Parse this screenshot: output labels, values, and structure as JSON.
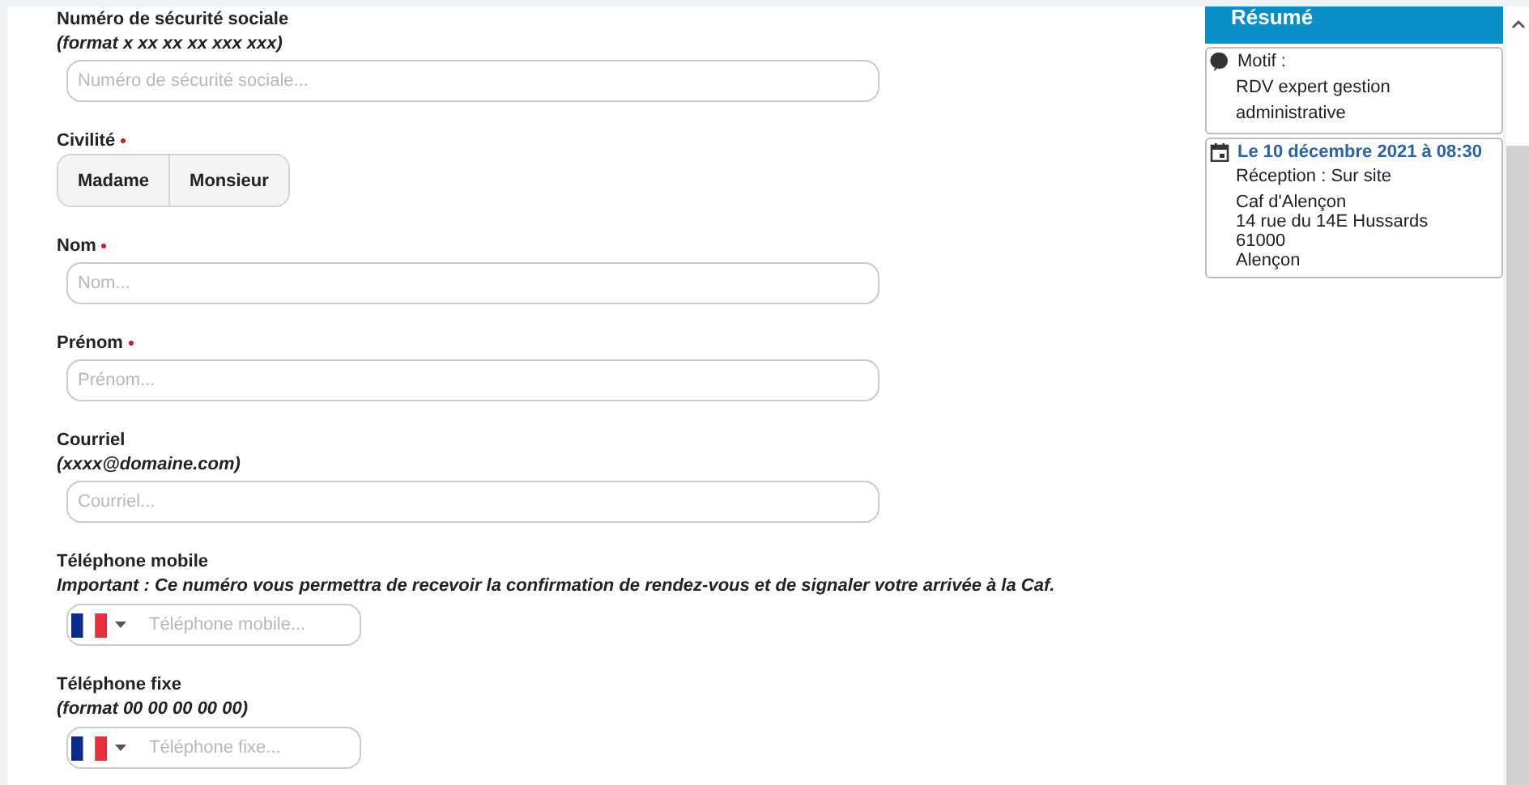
{
  "form": {
    "fields": [
      {
        "kind": "text",
        "label": "Numéro de sécurité sociale",
        "required": false,
        "hint": "(format x xx xx xx xxx xxx)",
        "placeholder": "Numéro de sécurité sociale..."
      },
      {
        "kind": "segmented",
        "label": "Civilité",
        "required": true,
        "options": [
          {
            "label": "Madame",
            "selected": false
          },
          {
            "label": "Monsieur",
            "selected": false
          }
        ]
      },
      {
        "kind": "text",
        "label": "Nom",
        "required": true,
        "placeholder": "Nom..."
      },
      {
        "kind": "text",
        "label": "Prénom",
        "required": true,
        "placeholder": "Prénom..."
      },
      {
        "kind": "text",
        "label": "Courriel",
        "required": false,
        "hint": "(xxxx@domaine.com)",
        "placeholder": "Courriel..."
      },
      {
        "kind": "phone",
        "label": "Téléphone mobile",
        "required": false,
        "hint": "Important : Ce numéro vous permettra de recevoir la confirmation de rendez-vous et de signaler votre arrivée à la Caf.",
        "placeholder": "Téléphone mobile..."
      },
      {
        "kind": "phone",
        "label": "Téléphone fixe",
        "required": false,
        "hint": "(format 00 00 00 00 00)",
        "placeholder": "Téléphone fixe..."
      }
    ]
  },
  "summary": {
    "title": "Résumé",
    "reason": {
      "label": "Motif :",
      "value": "RDV expert gestion administrative"
    },
    "appointment": {
      "date": "Le 10 décembre 2021 à 08:30",
      "reception": "Réception : Sur site",
      "address": [
        "Caf d'Alençon",
        "14 rue du 14E Hussards",
        "61000",
        "Alençon"
      ]
    }
  }
}
